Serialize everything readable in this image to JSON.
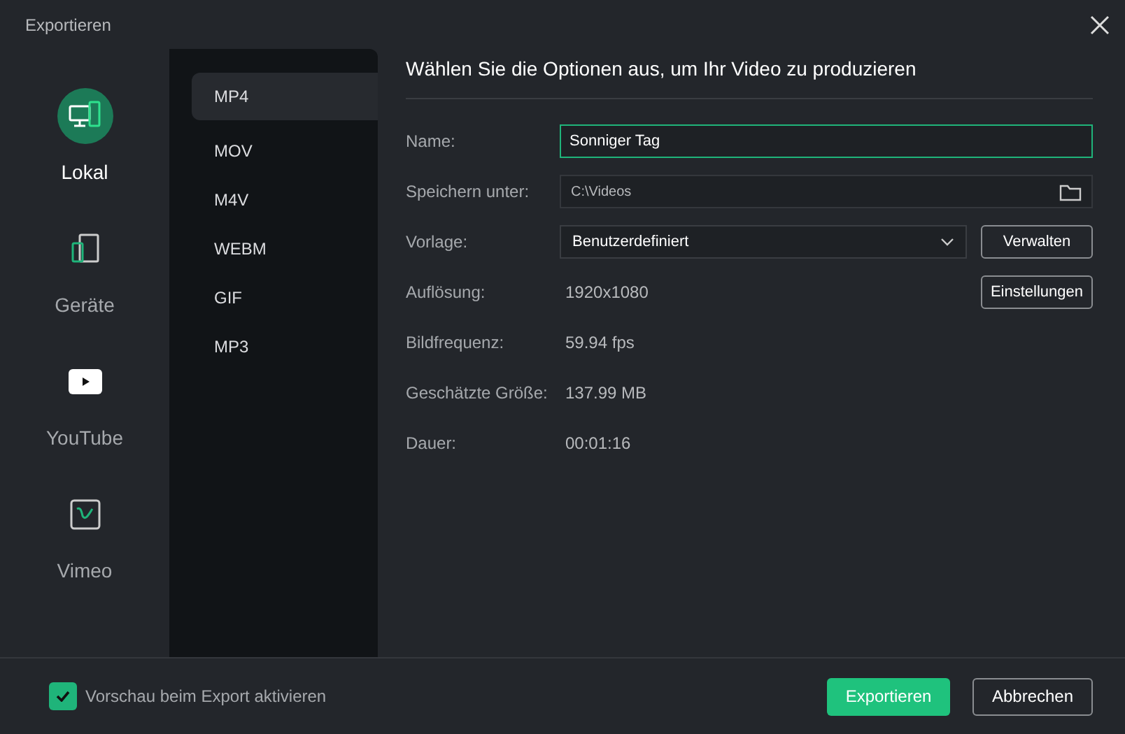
{
  "window": {
    "title": "Exportieren"
  },
  "destinations": [
    {
      "label": "Lokal",
      "kind": "local",
      "selected": true
    },
    {
      "label": "Geräte",
      "kind": "devices",
      "selected": false
    },
    {
      "label": "YouTube",
      "kind": "youtube",
      "selected": false
    },
    {
      "label": "Vimeo",
      "kind": "vimeo",
      "selected": false
    }
  ],
  "formats": [
    {
      "label": "MP4",
      "selected": true
    },
    {
      "label": "MOV",
      "selected": false
    },
    {
      "label": "M4V",
      "selected": false
    },
    {
      "label": "WEBM",
      "selected": false
    },
    {
      "label": "GIF",
      "selected": false
    },
    {
      "label": "MP3",
      "selected": false
    }
  ],
  "heading": "Wählen Sie die Optionen aus, um Ihr Video zu produzieren",
  "fields": [
    {
      "kind": "input",
      "label": "Name:",
      "value": "Sonniger Tag"
    },
    {
      "kind": "path",
      "label": "Speichern unter:",
      "value": "C:\\Videos"
    },
    {
      "kind": "select",
      "label": "Vorlage:",
      "value": "Benutzerdefiniert",
      "button": "Verwalten"
    },
    {
      "kind": "info",
      "label": "Auflösung:",
      "value": "1920x1080",
      "button": "Einstellungen"
    },
    {
      "kind": "info",
      "label": "Bildfrequenz:",
      "value": "59.94 fps"
    },
    {
      "kind": "info",
      "label": "Geschätzte Größe:",
      "value": "137.99 MB"
    },
    {
      "kind": "info",
      "label": "Dauer:",
      "value": "00:01:16"
    }
  ],
  "preview": {
    "label": "Vorschau beim Export aktivieren",
    "checked": true
  },
  "buttons": {
    "primary": "Exportieren",
    "secondary": "Abbrechen"
  }
}
